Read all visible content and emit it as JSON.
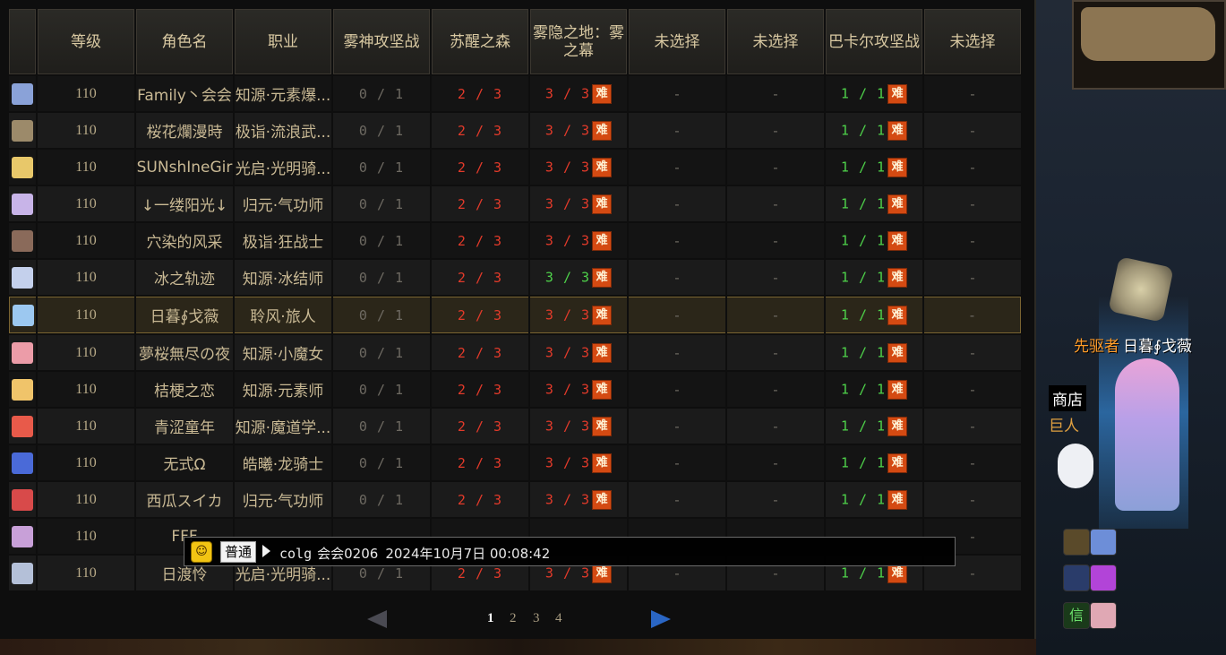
{
  "table": {
    "headers": [
      "",
      "等级",
      "角色名",
      "职业",
      "雾神攻坚战",
      "苏醒之森",
      "雾隐之地：雾之幕",
      "未选择",
      "未选择",
      "巴卡尔攻坚战",
      "未选择"
    ],
    "hard_badge": "难",
    "dash": "-",
    "rows": [
      {
        "level": "110",
        "name": "Family丶会会",
        "job": "知源·元素爆...",
        "fog_raid": "0 / 1",
        "forest": "2 / 3",
        "fog_land": "3 / 3",
        "fog_land_color": "red",
        "bakal": "1 / 1"
      },
      {
        "level": "110",
        "name": "桜花爛漫時",
        "job": "极诣·流浪武...",
        "fog_raid": "0 / 1",
        "forest": "2 / 3",
        "fog_land": "3 / 3",
        "fog_land_color": "red",
        "bakal": "1 / 1"
      },
      {
        "level": "110",
        "name": "SUNshIneGir",
        "job": "光启·光明骑...",
        "fog_raid": "0 / 1",
        "forest": "2 / 3",
        "fog_land": "3 / 3",
        "fog_land_color": "red",
        "bakal": "1 / 1"
      },
      {
        "level": "110",
        "name": "↓一缕阳光↓",
        "job": "归元·气功师",
        "fog_raid": "0 / 1",
        "forest": "2 / 3",
        "fog_land": "3 / 3",
        "fog_land_color": "red",
        "bakal": "1 / 1"
      },
      {
        "level": "110",
        "name": "穴染的风采",
        "job": "极诣·狂战士",
        "fog_raid": "0 / 1",
        "forest": "2 / 3",
        "fog_land": "3 / 3",
        "fog_land_color": "red",
        "bakal": "1 / 1"
      },
      {
        "level": "110",
        "name": "冰之轨迹",
        "job": "知源·冰结师",
        "fog_raid": "0 / 1",
        "forest": "2 / 3",
        "fog_land": "3 / 3",
        "fog_land_color": "green",
        "bakal": "1 / 1"
      },
      {
        "level": "110",
        "name": "日暮∮戈薇",
        "job": "聆风·旅人",
        "fog_raid": "0 / 1",
        "forest": "2 / 3",
        "fog_land": "3 / 3",
        "fog_land_color": "red",
        "bakal": "1 / 1",
        "selected": true
      },
      {
        "level": "110",
        "name": "夢桜無尽の夜",
        "job": "知源·小魔女",
        "fog_raid": "0 / 1",
        "forest": "2 / 3",
        "fog_land": "3 / 3",
        "fog_land_color": "red",
        "bakal": "1 / 1"
      },
      {
        "level": "110",
        "name": "桔梗之恋",
        "job": "知源·元素师",
        "fog_raid": "0 / 1",
        "forest": "2 / 3",
        "fog_land": "3 / 3",
        "fog_land_color": "red",
        "bakal": "1 / 1"
      },
      {
        "level": "110",
        "name": "青涩童年",
        "job": "知源·魔道学...",
        "fog_raid": "0 / 1",
        "forest": "2 / 3",
        "fog_land": "3 / 3",
        "fog_land_color": "red",
        "bakal": "1 / 1"
      },
      {
        "level": "110",
        "name": "无式Ω",
        "job": "皓曦·龙骑士",
        "fog_raid": "0 / 1",
        "forest": "2 / 3",
        "fog_land": "3 / 3",
        "fog_land_color": "red",
        "bakal": "1 / 1"
      },
      {
        "level": "110",
        "name": "西瓜スイカ",
        "job": "归元·气功师",
        "fog_raid": "0 / 1",
        "forest": "2 / 3",
        "fog_land": "3 / 3",
        "fog_land_color": "red",
        "bakal": "1 / 1"
      },
      {
        "level": "110",
        "name": "FFF",
        "job": "",
        "fog_raid": "",
        "forest": "",
        "fog_land": "",
        "fog_land_color": "red",
        "bakal": "",
        "partially_hidden": true
      },
      {
        "level": "110",
        "name": "日渡怜",
        "job": "光启·光明骑...",
        "fog_raid": "0 / 1",
        "forest": "2 / 3",
        "fog_land": "3 / 3",
        "fog_land_color": "red",
        "bakal": "1 / 1"
      }
    ],
    "avatar_colors": [
      "#8aa2d8",
      "#9c8a6a",
      "#e8c86a",
      "#c8b4e8",
      "#8a6a5a",
      "#c4d0ec",
      "#9cc8f0",
      "#ec9ca8",
      "#f0c46a",
      "#e85a4a",
      "#4a6ad8",
      "#d84a4a",
      "#c8a0d8",
      "#b4c0d8"
    ]
  },
  "pagination": {
    "pages": [
      "1",
      "2",
      "3",
      "4"
    ],
    "active": "1"
  },
  "chat": {
    "channel": "普通",
    "sender": "colg",
    "text": "会会0206",
    "time": "2024年10月7日 00:08:42"
  },
  "scene": {
    "player_title": "先驱者",
    "player_name": "日暮∮戈薇",
    "shop_label": "商店",
    "giant_label": "巨人",
    "icon_text": "信"
  }
}
